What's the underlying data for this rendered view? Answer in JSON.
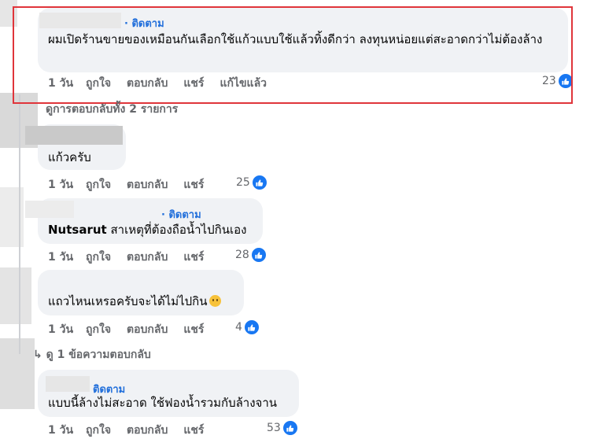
{
  "follow_label": "· ติดตาม",
  "follow_label_plain": "ติดตาม",
  "actions": {
    "like": "ถูกใจ",
    "reply": "ตอบกลับ",
    "share": "แชร์",
    "edited": "แก้ไขแล้ว"
  },
  "comments": [
    {
      "text": "ผมเปิดร้านขายของเหมือนกันเลือกใช้แก้วแบบใช้แล้วทิ้งดีกว่า ลงทุนหน่อยแต่สะอาดกว่าไม่ต้องล้าง",
      "time": "1 วัน",
      "likes": "23"
    },
    {
      "text": "แก้วครับ",
      "time": "1 วัน",
      "likes": "25"
    },
    {
      "author": "Nutsarut",
      "text": "สาเหตุที่ต้องถือน้ำไปกินเอง",
      "time": "1 วัน",
      "likes": "28"
    },
    {
      "text": "แถวไหนเหรอครับจะได้ไม่ไปกิน",
      "emoji": "sad-face-emoji",
      "time": "1 วัน",
      "likes": "4"
    },
    {
      "text": "แบบนี้ล้างไม่สะอาด ใช้ฟองน้ำรวมกับล้างจาน",
      "time": "1 วัน",
      "likes": "53"
    }
  ],
  "view_all_replies": "ดูการตอบกลับทั้ง 2 รายการ",
  "view_one_reply": "ดู 1 ข้อความตอบกลับ",
  "colors": {
    "accent": "#216fdb",
    "like_blue": "#1877f2",
    "highlight_red": "#e0353b",
    "bubble": "#f0f2f5"
  }
}
